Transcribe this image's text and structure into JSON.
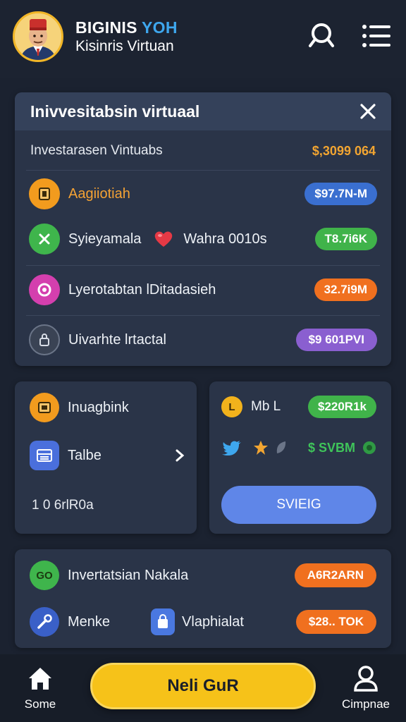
{
  "header": {
    "title_main": "BIGINIS",
    "title_accent": "YOH",
    "subtitle": "Kisinris Virtuan",
    "icons": [
      "avatar",
      "search-icon",
      "menu-icon"
    ]
  },
  "investments": {
    "title": "Inivvesitabsin virtuaal",
    "summary_label": "Investarasen Vintuabs",
    "summary_value": "$,3099 064",
    "rows": [
      {
        "label": "Aagiiotiah",
        "pill": "$97.7N-M",
        "color": "#3a6fd0",
        "icon": "square-icon",
        "icon_color": "#f29b1e"
      },
      {
        "label": "Syieyamala",
        "extra": "Wahra 0010s",
        "pill": "T8.7i6K",
        "color": "#40b34a",
        "icon": "cross-icon",
        "icon_color": "#3fb54c"
      },
      {
        "label": "Lyerotabtan lDitadasieh",
        "pill": "32.7i9M",
        "color": "#f0701f",
        "icon": "ring-icon",
        "icon_color": "#d43fae"
      },
      {
        "label": "Uivarhte lrtactal",
        "pill": "$9 601PVI",
        "color": "#8a5fd0",
        "icon": "lock-icon",
        "icon_color": "#3a4354"
      }
    ]
  },
  "left_card": {
    "item1": "Inuagbink",
    "item2": "Talbe",
    "footer": "1 0 6rlR0a"
  },
  "right_card": {
    "item1": "Mb L",
    "item1_pill": "$220R1k",
    "item2_value": "$ SVBM",
    "button": "SVIEIG"
  },
  "bottom_card": {
    "item1": "Invertatsian Nakala",
    "item1_pill": "A6R2ARN",
    "item2": "Menke",
    "item3": "Vlaphialat",
    "item3_pill": "$28.. TOK"
  },
  "nav": {
    "home": "Some",
    "cta": "Neli GuR",
    "profile": "Cimpnae"
  },
  "colors": {
    "background": "#1b2230",
    "card": "#2a3448",
    "accent_orange": "#f4a234",
    "accent_blue": "#5f86e8",
    "cta_yellow": "#f6c219"
  }
}
